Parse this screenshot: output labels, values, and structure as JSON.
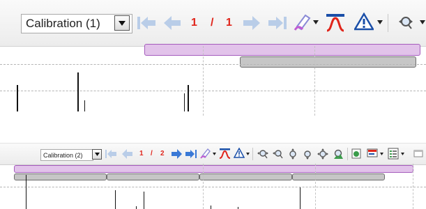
{
  "views": [
    {
      "toolbar": {
        "selector_value": "Calibration (1)",
        "page_current": "1",
        "page_separator": "/",
        "page_total": "1"
      }
    },
    {
      "toolbar": {
        "selector_value": "Calibration (2)",
        "page_current": "1",
        "page_separator": "/",
        "page_total": "2"
      }
    }
  ],
  "icons": {
    "nav": [
      "first-page-icon",
      "previous-page-icon",
      "next-page-icon",
      "last-page-icon"
    ],
    "tools": [
      "highlighter-icon",
      "peak-shape-icon",
      "warning-triangle-icon",
      "zoom-tool-icon"
    ],
    "colors": {
      "nav_blue_active": "#3a79d6",
      "nav_blue_disabled": "#b9cde8",
      "page_red": "#e0251b",
      "range_purple": "#e2c3ea",
      "range_gray": "#c6c6c6"
    }
  }
}
